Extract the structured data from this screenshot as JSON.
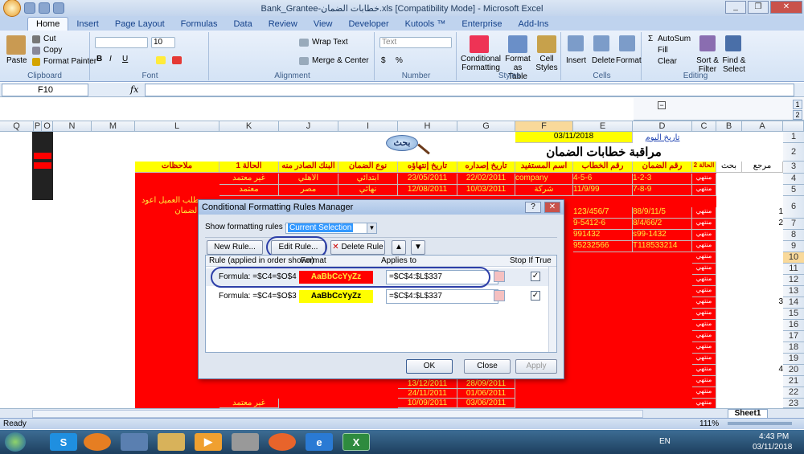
{
  "window": {
    "title": "Bank_Grantee-خطابات الضمان.xls [Compatibility Mode] - Microsoft Excel"
  },
  "tabs": [
    "Home",
    "Insert",
    "Page Layout",
    "Formulas",
    "Data",
    "Review",
    "View",
    "Developer",
    "Kutools ™",
    "Enterprise",
    "Add-Ins"
  ],
  "ribbon": {
    "clipboard": {
      "paste": "Paste",
      "cut": "Cut",
      "copy": "Copy",
      "format_painter": "Format Painter",
      "label": "Clipboard"
    },
    "font": {
      "size": "10",
      "label": "Font"
    },
    "alignment": {
      "wrap": "Wrap Text",
      "merge": "Merge & Center",
      "label": "Alignment"
    },
    "number": {
      "format": "Text",
      "label": "Number"
    },
    "styles": {
      "cond": "Conditional Formatting",
      "table": "Format as Table",
      "cell": "Cell Styles",
      "label": "Styles"
    },
    "cells": {
      "insert": "Insert",
      "delete": "Delete",
      "format": "Format",
      "label": "Cells"
    },
    "editing": {
      "autosum": "AutoSum",
      "fill": "Fill",
      "clear": "Clear",
      "sort": "Sort & Filter",
      "find": "Find & Select",
      "label": "Editing"
    }
  },
  "formula_bar": {
    "name_box": "F10",
    "fx": "fx"
  },
  "columns": [
    "Q",
    "P",
    "O",
    "N",
    "M",
    "L",
    "K",
    "J",
    "I",
    "H",
    "G",
    "F",
    "E",
    "D",
    "C",
    "B",
    "A"
  ],
  "rows": [
    "1",
    "2",
    "3",
    "4",
    "5",
    "6",
    "7",
    "8",
    "9",
    "10",
    "11",
    "12",
    "13",
    "14",
    "15",
    "16",
    "17",
    "18",
    "19",
    "20",
    "21",
    "22",
    "23"
  ],
  "sheet": {
    "date_value": "03/11/2018",
    "date_label": "تاريخ اليوم",
    "main_title": "مراقبة خطابات الضمان",
    "search_label": "بحث",
    "headers": {
      "notes": "ملاحظات",
      "status1": "الحالة 1",
      "bank": "البنك الصادر منه",
      "type": "نوع الضمان",
      "end_date": "تاريخ إنتهاؤه",
      "issue_date": "تاريخ إصداره",
      "beneficiary": "اسم المستفيد",
      "letter_no": "رقم الخطاب",
      "guarantee_no": "رقم الضمان",
      "status2": "الحالة 2",
      "search": "بحث",
      "ref": "مرجع"
    },
    "row4": {
      "status": "غير معتمد",
      "bank": "الأهلي",
      "type": "ابتدائي",
      "end": "23/05/2011",
      "issue": "22/02/2011",
      "beneficiary": "company",
      "letter": "4-5-6",
      "guarantee": "1-2-3",
      "c": "منتهي"
    },
    "row5": {
      "status": "معتمد",
      "bank": "مصر",
      "type": "نهائي",
      "end": "12/08/2011",
      "issue": "10/03/2011",
      "beneficiary": "شركة",
      "letter": "11/9/99",
      "guarantee": "7-8-9",
      "c": "منتهي"
    },
    "note6": "طلب العميل اعود",
    "note6b": "الضمان",
    "row6": {
      "letter": "123/456/7",
      "guarantee": "88/9/11/5",
      "ref": "1"
    },
    "row7": {
      "letter": "9-5412-6",
      "guarantee": "8/4/66/2",
      "ref": "2"
    },
    "row8": {
      "letter": "991432",
      "guarantee": "s99-1432"
    },
    "row9": {
      "letter": "95232566",
      "guarantee": "T118533214"
    },
    "row14_ref": "3",
    "row20_ref": "4",
    "c_status": "منتهي",
    "dates_bottom": [
      {
        "end": "13/12/2011",
        "issue": "28/09/2011"
      },
      {
        "end": "24/11/2011",
        "issue": "01/06/2011"
      },
      {
        "end": "10/09/2011",
        "issue": "03/06/2011"
      }
    ],
    "row23_status": "غير معتمد"
  },
  "dialog": {
    "title": "Conditional Formatting Rules Manager",
    "show_label": "Show formatting rules for:",
    "show_value": "Current Selection",
    "new_rule": "New Rule...",
    "edit_rule": "Edit Rule...",
    "delete_rule": "Delete Rule",
    "col_rule": "Rule (applied in order shown)",
    "col_format": "Format",
    "col_applies": "Applies to",
    "col_stop": "Stop If True",
    "rules": [
      {
        "formula": "Formula: =$C4=$O$4",
        "preview": "AaBbCcYyZz",
        "applies": "=$C$4:$L$337",
        "stop": "✓"
      },
      {
        "formula": "Formula: =$C4=$O$3",
        "preview": "AaBbCcYyZz",
        "applies": "=$C$4:$L$337",
        "stop": "✓"
      }
    ],
    "ok": "OK",
    "close": "Close",
    "apply": "Apply",
    "help": "?"
  },
  "status": {
    "ready": "Ready",
    "zoom": "111%",
    "sheet_tab": "Sheet1"
  },
  "taskbar": {
    "lang": "EN",
    "time": "4:43 PM",
    "date": "03/11/2018"
  },
  "colors": {
    "red": "#ff0000",
    "yellow": "#ffff00",
    "accent": "#2d3fa8"
  }
}
